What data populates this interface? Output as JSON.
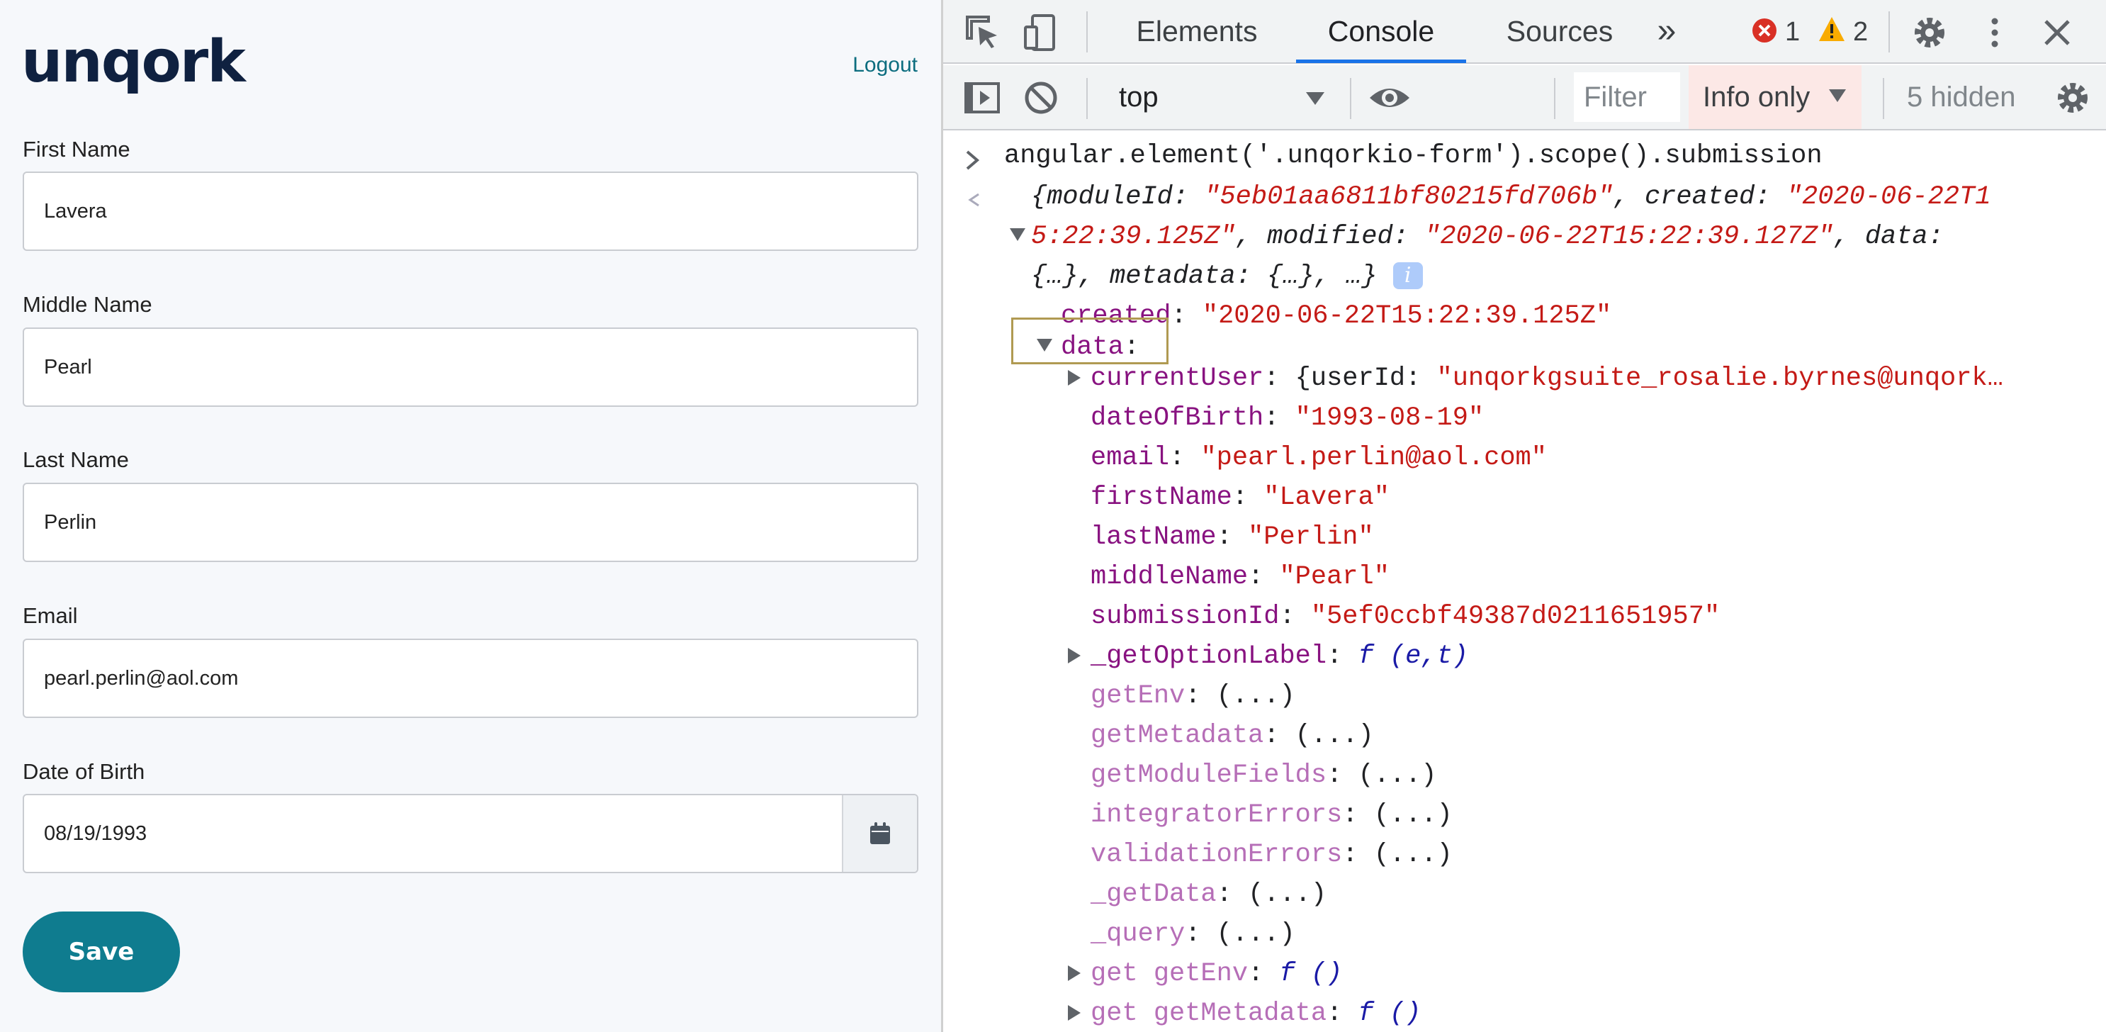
{
  "form": {
    "logo": "unqork",
    "logout_label": "Logout",
    "fields": [
      {
        "label": "First Name",
        "value": "Lavera"
      },
      {
        "label": "Middle Name",
        "value": "Pearl"
      },
      {
        "label": "Last Name",
        "value": "Perlin"
      },
      {
        "label": "Email",
        "value": "pearl.perlin@aol.com"
      }
    ],
    "dob": {
      "label": "Date of Birth",
      "value": "08/19/1993",
      "icon": "calendar-icon"
    },
    "save_label": "Save",
    "colors": {
      "brand": "#0f2140",
      "accent": "#0f7c8f",
      "link": "#0c6d7f"
    }
  },
  "devtools": {
    "tabs": [
      "Elements",
      "Console",
      "Sources"
    ],
    "active_tab": "Console",
    "more_tabs": "»",
    "errors": "1",
    "warnings": "2",
    "context": "top",
    "filter_placeholder": "Filter",
    "level": "Info only",
    "hidden": "5 hidden",
    "console": {
      "command": "angular.element('.unqorkio-form').scope().submission",
      "summary": {
        "l1_a": "{moduleId: ",
        "l1_b": "\"5eb01aa6811bf80215fd706b\"",
        "l1_c": ", created: ",
        "l1_d": "\"2020-06-22T1",
        "l2_a": "5:22:39.125Z\"",
        "l2_b": ", modified: ",
        "l2_c": "\"2020-06-22T15:22:39.127Z\"",
        "l2_d": ", data:",
        "l3": "{…}, metadata: {…}, …}",
        "info": "i"
      },
      "created_key": "created",
      "created_val": "\"2020-06-22T15:22:39.125Z\"",
      "data_key": "data",
      "current_user_key": "currentUser",
      "current_user_a": "{userId: ",
      "current_user_b": "\"unqorkgsuite_rosalie.byrnes@unqork…",
      "props": [
        {
          "key": "dateOfBirth",
          "val": "\"1993-08-19\""
        },
        {
          "key": "email",
          "val": "\"pearl.perlin@aol.com\""
        },
        {
          "key": "firstName",
          "val": "\"Lavera\""
        },
        {
          "key": "lastName",
          "val": "\"Perlin\""
        },
        {
          "key": "middleName",
          "val": "\"Pearl\""
        },
        {
          "key": "submissionId",
          "val": "\"5ef0ccbf49387d0211651957\""
        }
      ],
      "get_option_key": "_getOptionLabel",
      "get_option_val": "f (e,t)",
      "lazy_props": [
        "getEnv",
        "getMetadata",
        "getModuleFields",
        "integratorErrors",
        "validationErrors",
        "_getData",
        "_query"
      ],
      "lazy_val": "(...)",
      "getters": [
        {
          "key": "get getEnv",
          "val": "f ()"
        },
        {
          "key": "get getMetadata",
          "val": "f ()"
        }
      ]
    }
  }
}
